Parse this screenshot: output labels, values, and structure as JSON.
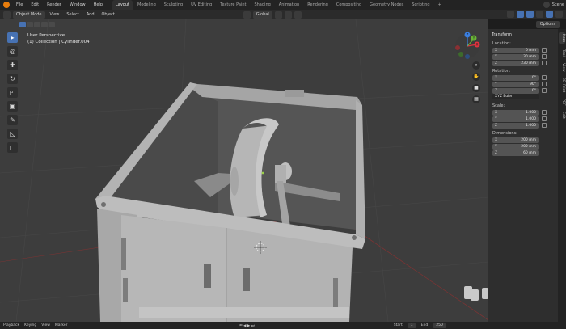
{
  "topbar": {
    "menus": [
      "File",
      "Edit",
      "Render",
      "Window",
      "Help"
    ],
    "workspaces": [
      "Layout",
      "Modeling",
      "Sculpting",
      "UV Editing",
      "Texture Paint",
      "Shading",
      "Animation",
      "Rendering",
      "Compositing",
      "Geometry Nodes",
      "Scripting"
    ],
    "add_tab": "+",
    "scene": "Scene"
  },
  "header": {
    "mode": "Object Mode",
    "menus": [
      "View",
      "Select",
      "Add",
      "Object"
    ],
    "orientation": "Global",
    "options": "Options"
  },
  "viewport": {
    "view_name": "User Perspective",
    "collection": "(1) Collection | Cylinder.004"
  },
  "npanel": {
    "title": "Transform",
    "location_label": "Location:",
    "location": [
      {
        "axis": "X",
        "value": "0 mm"
      },
      {
        "axis": "Y",
        "value": "30 mm"
      },
      {
        "axis": "Z",
        "value": "230 mm"
      }
    ],
    "rotation_label": "Rotation:",
    "rotation": [
      {
        "axis": "X",
        "value": "0°"
      },
      {
        "axis": "Y",
        "value": "90°"
      },
      {
        "axis": "Z",
        "value": "0°"
      }
    ],
    "rotation_mode": "XYZ Euler",
    "scale_label": "Scale:",
    "scale": [
      {
        "axis": "X",
        "value": "1.000"
      },
      {
        "axis": "Y",
        "value": "1.000"
      },
      {
        "axis": "Z",
        "value": "1.000"
      }
    ],
    "dimensions_label": "Dimensions:",
    "dimensions": [
      {
        "axis": "X",
        "value": "200 mm"
      },
      {
        "axis": "Y",
        "value": "200 mm"
      },
      {
        "axis": "Z",
        "value": "60 mm"
      }
    ],
    "tabs": [
      "Item",
      "Tool",
      "View",
      "3D-Print",
      "PDF",
      "Edit"
    ]
  },
  "gizmo": {
    "x": "X",
    "y": "Y",
    "z": "Z"
  },
  "timeline": {
    "playback": "Playback",
    "keying": "Keying",
    "view": "View",
    "marker": "Marker",
    "start_label": "Start",
    "start": "1",
    "end_label": "End",
    "end": "250"
  },
  "colors": {
    "accent": "#4772b3",
    "gizmo_x": "#e0333f",
    "gizmo_y": "#6ab637",
    "gizmo_z": "#3a7fe0",
    "logo": "#e87d0d"
  }
}
